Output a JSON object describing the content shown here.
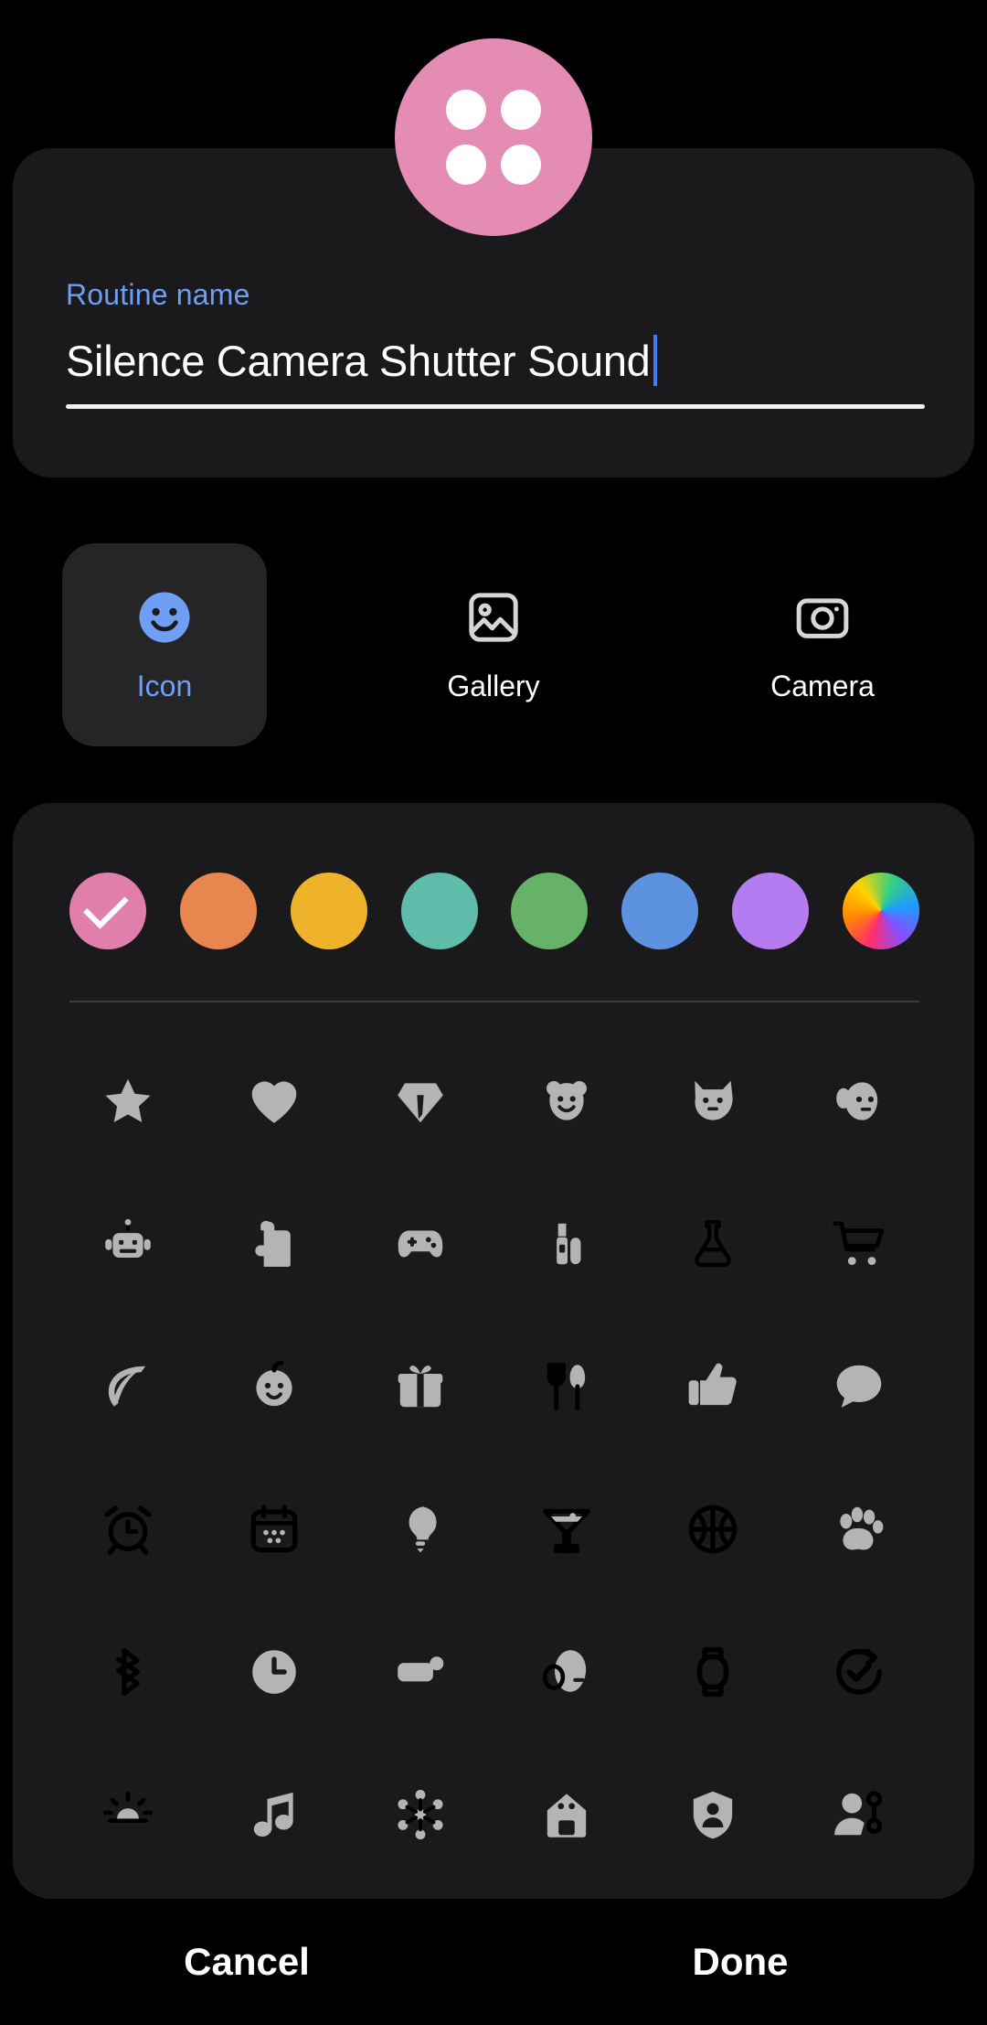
{
  "avatar": {
    "name": "routine-avatar",
    "background_color": "#e48cb4",
    "dot_color": "#ffffff",
    "dot_count": 4
  },
  "name_field": {
    "label": "Routine name",
    "value": "Silence Camera Shutter Sound",
    "placeholder": "Routine name",
    "label_color": "#6f9ef5",
    "caret_color": "#3b7dfb"
  },
  "source_tabs": {
    "selected": "Icon",
    "items": [
      {
        "label": "Icon",
        "icon": "smiley-face-icon",
        "selected": true
      },
      {
        "label": "Gallery",
        "icon": "image-icon",
        "selected": false
      },
      {
        "label": "Camera",
        "icon": "camera-icon",
        "selected": false
      }
    ]
  },
  "color_swatches": {
    "selected_index": 0,
    "items": [
      {
        "name": "pink",
        "color": "#e07fab",
        "selected": true
      },
      {
        "name": "orange",
        "color": "#e8864f",
        "selected": false
      },
      {
        "name": "yellow",
        "color": "#eeb32a",
        "selected": false
      },
      {
        "name": "teal",
        "color": "#5fbcab",
        "selected": false
      },
      {
        "name": "green",
        "color": "#66b268",
        "selected": false
      },
      {
        "name": "blue",
        "color": "#5d92e0",
        "selected": false
      },
      {
        "name": "purple",
        "color": "#b47cf0",
        "selected": false
      },
      {
        "name": "rainbow",
        "color": "gradient",
        "selected": false
      }
    ]
  },
  "icon_grid": {
    "columns": 6,
    "rows": 6,
    "icon_color": "#b4b4b6",
    "items": [
      "star-icon",
      "heart-icon",
      "diamond-icon",
      "bear-icon",
      "cat-icon",
      "dog-icon",
      "robot-icon",
      "puzzle-icon",
      "gamepad-icon",
      "lipstick-icon",
      "flask-icon",
      "shopping-cart-icon",
      "leaf-icon",
      "baby-icon",
      "gift-icon",
      "utensils-icon",
      "thumbs-up-icon",
      "chat-bubble-icon",
      "alarm-clock-icon",
      "calendar-icon",
      "lightbulb-icon",
      "cocktail-icon",
      "basketball-icon",
      "paw-icon",
      "bluetooth-icon",
      "clock-icon",
      "battery-icon",
      "earbud-icon",
      "watch-icon",
      "refresh-check-icon",
      "brightness-icon",
      "music-note-icon",
      "network-icon",
      "smart-home-icon",
      "shield-person-icon",
      "person-settings-icon"
    ]
  },
  "footer": {
    "cancel_label": "Cancel",
    "done_label": "Done"
  }
}
